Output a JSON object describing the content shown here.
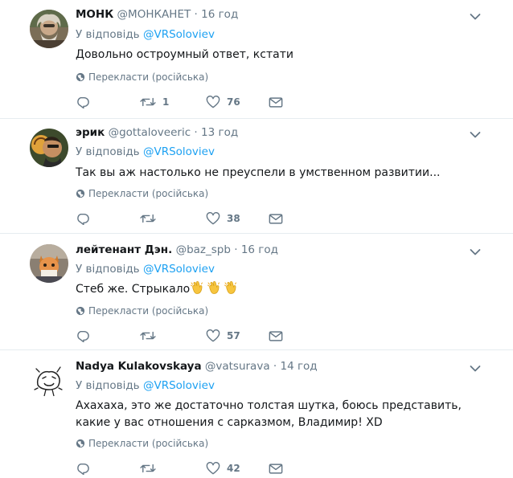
{
  "reply_prefix": "У відповідь",
  "translate_label": "Перекласти (російська)",
  "colors": {
    "link": "#1da1f2",
    "muted": "#657786",
    "divider": "#e6ecf0",
    "text": "#14171a"
  },
  "tweets": [
    {
      "name": "МОНК",
      "handle": "@МОНКАНЕТ",
      "sep": "·",
      "time": "16 год",
      "reply_to": "@VRSoloviev",
      "text": "Довольно остроумный ответ, кстати",
      "retweets": "1",
      "likes": "76"
    },
    {
      "name": "эрик",
      "handle": "@gottaloveeric",
      "sep": "·",
      "time": "13 год",
      "reply_to": "@VRSoloviev",
      "text": "Так вы аж настолько не преуспели в умственном развитии...",
      "retweets": "",
      "likes": "38"
    },
    {
      "name": "лейтенант Дэн.",
      "handle": "@baz_spb",
      "sep": "·",
      "time": "16 год",
      "reply_to": "@VRSoloviev",
      "text": "Стеб же. Стрыкало",
      "emojis": [
        "clapping-hands",
        "clapping-hands",
        "clapping-hands"
      ],
      "retweets": "",
      "likes": "57"
    },
    {
      "name": "Nadya Kulakovskaya",
      "handle": "@vatsurava",
      "sep": "·",
      "time": "14 год",
      "reply_to": "@VRSoloviev",
      "text": "Ахахаха, это же достаточно толстая шутка, боюсь представить, какие у вас отношения с сарказмом, Владимир! XD",
      "retweets": "",
      "likes": "42"
    }
  ]
}
